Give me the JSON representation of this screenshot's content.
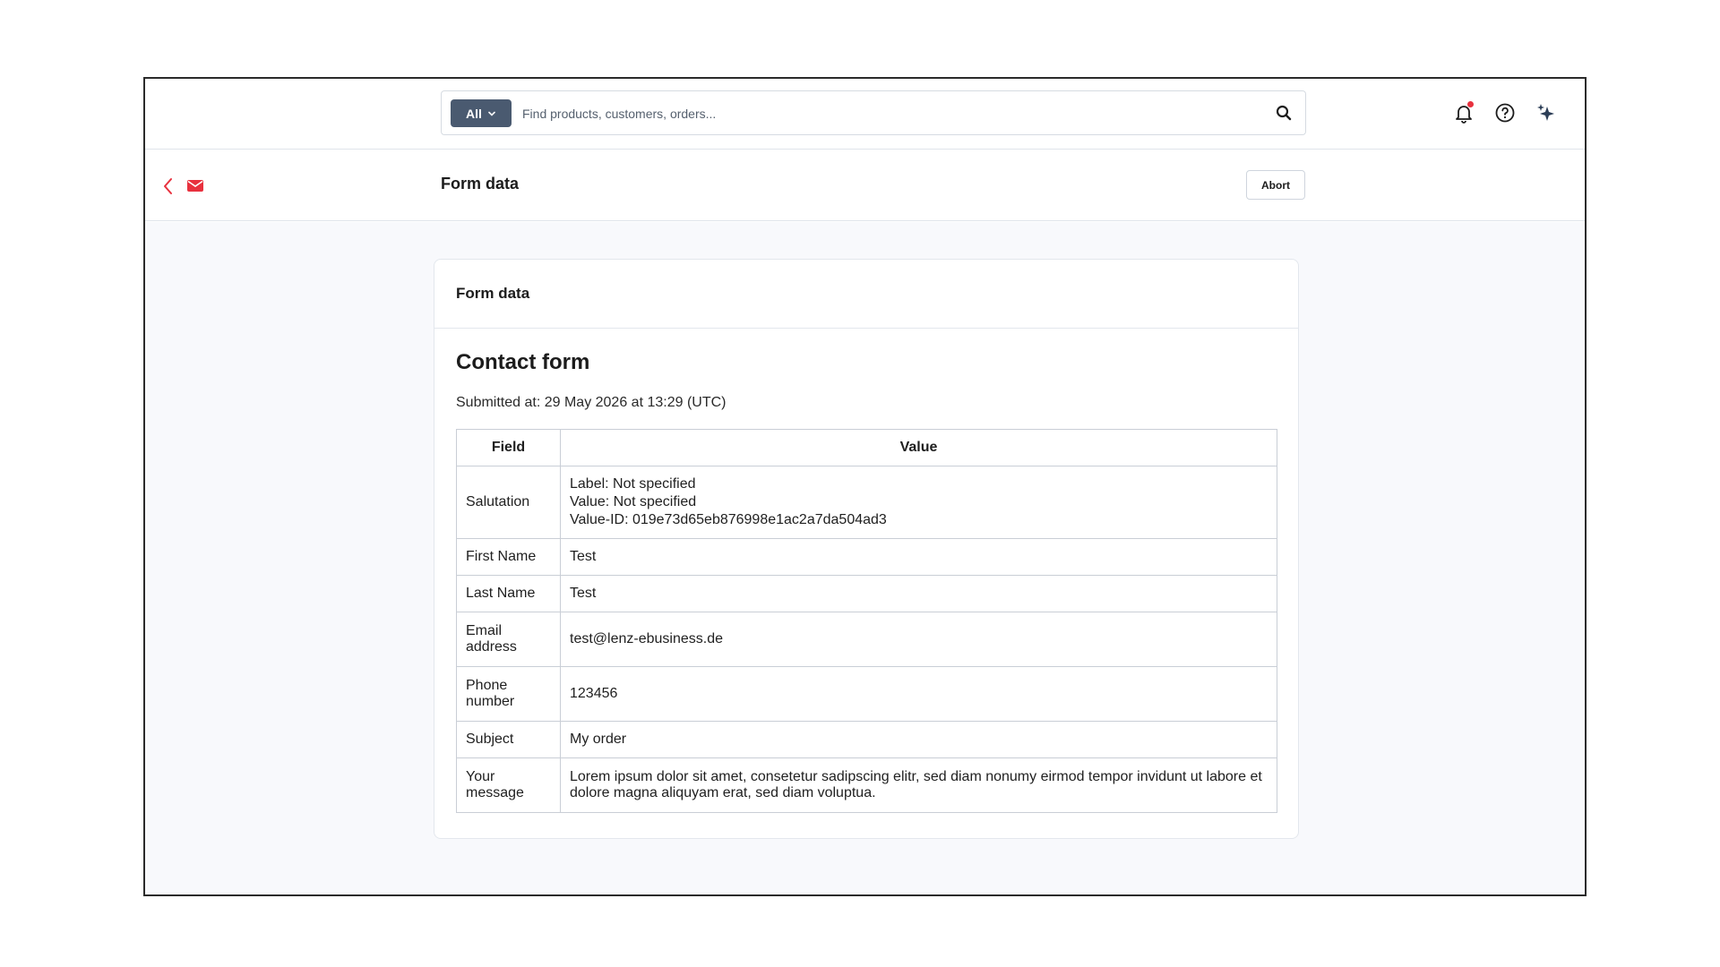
{
  "header": {
    "search": {
      "filter_label": "All",
      "placeholder": "Find products, customers, orders..."
    },
    "icons": [
      "bell-icon",
      "help-icon",
      "sparkle-icon"
    ],
    "accent_color": "#e8313e"
  },
  "subheader": {
    "title": "Form data",
    "abort_label": "Abort"
  },
  "card": {
    "header_title": "Form data",
    "form_title": "Contact form",
    "submitted_at": "Submitted at: 29 May 2026 at 13:29 (UTC)",
    "table": {
      "columns": [
        "Field",
        "Value"
      ],
      "rows": [
        {
          "field": "Salutation",
          "value_lines": [
            "Label: Not specified",
            "Value: Not specified",
            "Value-ID: 019e73d65eb876998e1ac2a7da504ad3"
          ]
        },
        {
          "field": "First Name",
          "value": "Test"
        },
        {
          "field": "Last Name",
          "value": "Test"
        },
        {
          "field": "Email address",
          "value": "test@lenz-ebusiness.de"
        },
        {
          "field": "Phone number",
          "value": "123456"
        },
        {
          "field": "Subject",
          "value": "My order"
        },
        {
          "field": "Your message",
          "value": "Lorem ipsum dolor sit amet, consetetur sadipscing elitr, sed diam nonumy eirmod tempor invidunt ut labore et dolore magna aliquyam erat, sed diam voluptua."
        }
      ]
    }
  }
}
